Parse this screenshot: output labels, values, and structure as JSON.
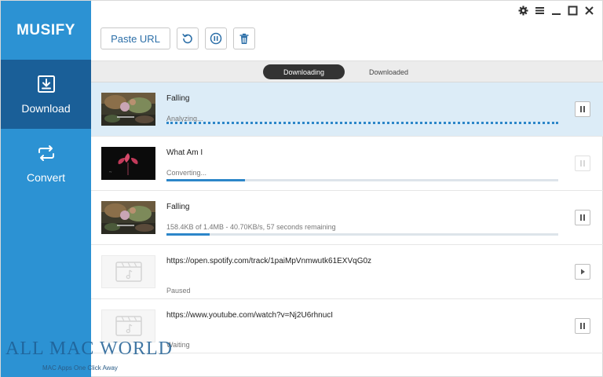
{
  "app": {
    "brand": "MUSIFY"
  },
  "sidebar": {
    "items": [
      {
        "label": "Download",
        "icon": "download-icon",
        "active": true
      },
      {
        "label": "Convert",
        "icon": "convert-icon",
        "active": false
      }
    ]
  },
  "window_controls": [
    "gear-icon",
    "menu-icon",
    "minimize-icon",
    "maximize-icon",
    "close-icon"
  ],
  "toolbar": {
    "paste_label": "Paste URL",
    "icons": [
      "refresh-icon",
      "pause-all-icon",
      "trash-icon"
    ]
  },
  "tabs": [
    {
      "label": "Downloading",
      "active": true
    },
    {
      "label": "Downloaded",
      "active": false
    }
  ],
  "downloads": [
    {
      "title": "Falling",
      "status": "Analyzing...",
      "progress": 1.0,
      "action": "pause-icon",
      "state": "analyzing"
    },
    {
      "title": "What Am I",
      "status": "Converting...",
      "progress": 0.2,
      "action": "pause-icon",
      "state": "converting"
    },
    {
      "title": "Falling",
      "status": "158.4KB of 1.4MB - 40.70KB/s, 57 seconds remaining",
      "progress": 0.11,
      "action": "pause-icon",
      "state": "downloading"
    },
    {
      "title": "https://open.spotify.com/track/1paiMpVnmwutk61EXVqG0z",
      "status": "Paused",
      "progress": 0,
      "action": "play-icon",
      "state": "paused"
    },
    {
      "title": "https://www.youtube.com/watch?v=Nj2U6rhnucI",
      "status": "Waiting",
      "progress": 0,
      "action": "pause-icon",
      "state": "waiting"
    }
  ],
  "watermark": {
    "brand": "ALL MAC WORLD",
    "tagline": "MAC Apps One Click Away"
  },
  "colors": {
    "sidebar": "#2c92d3",
    "sidebar_active": "#1a5f98",
    "selected_row": "#dcecf7",
    "progress": "#2c86c9",
    "tab_active": "#333333"
  }
}
